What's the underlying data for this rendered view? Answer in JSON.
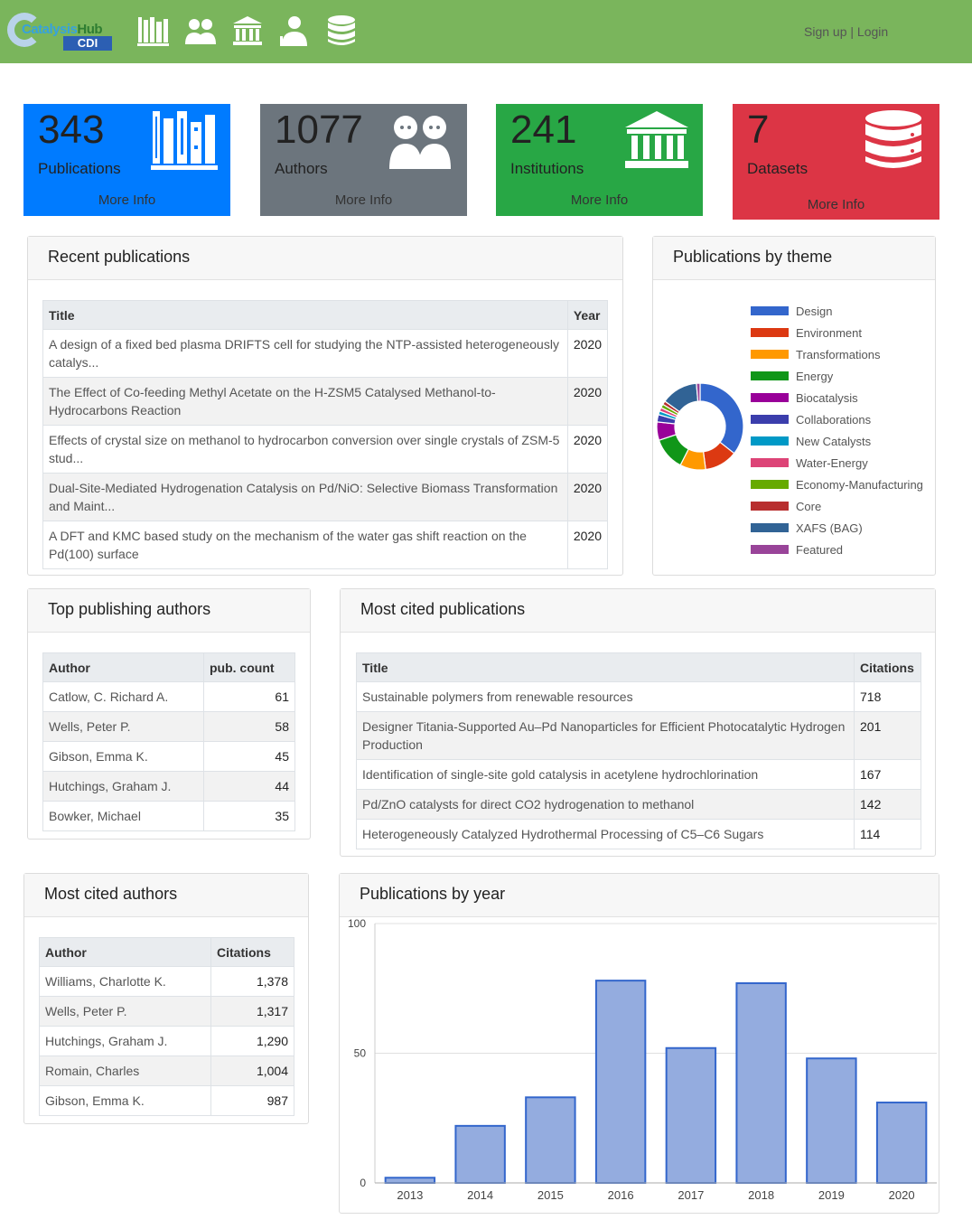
{
  "brand": {
    "logo_text_a": "Catalysis",
    "logo_text_b": "Hub",
    "logo_sub": "CDI"
  },
  "nav": {
    "icons": [
      "publications-icon",
      "authors-icon",
      "institutions-icon",
      "experts-icon",
      "datasets-icon"
    ]
  },
  "auth": {
    "signup": "Sign up",
    "sep": "|",
    "login": "Login"
  },
  "stats": [
    {
      "value": "343",
      "label": "Publications",
      "more": "More Info",
      "color": "#007bff",
      "icon": "books-icon"
    },
    {
      "value": "1077",
      "label": "Authors",
      "more": "More Info",
      "color": "#6c757d",
      "icon": "people-icon"
    },
    {
      "value": "241",
      "label": "Institutions",
      "more": "More Info",
      "color": "#28a745",
      "icon": "bank-icon"
    },
    {
      "value": "7",
      "label": "Datasets",
      "more": "More Info",
      "color": "#dc3545",
      "icon": "database-icon"
    }
  ],
  "recent": {
    "title": "Recent publications",
    "col_title": "Title",
    "col_year": "Year",
    "rows": [
      {
        "title": "A design of a fixed bed plasma DRIFTS cell for studying the NTP-assisted heterogeneously catalys...",
        "year": "2020"
      },
      {
        "title": "The Effect of Co-feeding Methyl Acetate on the H-ZSM5 Catalysed Methanol-to-Hydrocarbons Reaction",
        "year": "2020"
      },
      {
        "title": "Effects of crystal size on methanol to hydrocarbon conversion over single crystals of ZSM-5 stud...",
        "year": "2020"
      },
      {
        "title": "Dual-Site-Mediated Hydrogenation Catalysis on Pd/NiO: Selective Biomass Transformation and Maint...",
        "year": "2020"
      },
      {
        "title": "A DFT and KMC based study on the mechanism of the water gas shift reaction on the Pd(100) surface",
        "year": "2020"
      }
    ]
  },
  "theme": {
    "title": "Publications by theme",
    "items": [
      {
        "name": "Design",
        "color": "#3366cc"
      },
      {
        "name": "Environment",
        "color": "#dc3912"
      },
      {
        "name": "Transformations",
        "color": "#ff9900"
      },
      {
        "name": "Energy",
        "color": "#109618"
      },
      {
        "name": "Biocatalysis",
        "color": "#990099"
      },
      {
        "name": "Collaborations",
        "color": "#3b3eac"
      },
      {
        "name": "New Catalysts",
        "color": "#0099c6"
      },
      {
        "name": "Water-Energy",
        "color": "#dd4477"
      },
      {
        "name": "Economy-Manufacturing",
        "color": "#66aa00"
      },
      {
        "name": "Core",
        "color": "#b82e2e"
      },
      {
        "name": "XAFS (BAG)",
        "color": "#316395"
      },
      {
        "name": "Featured",
        "color": "#994499"
      }
    ]
  },
  "topauthors": {
    "title": "Top publishing authors",
    "col_author": "Author",
    "col_count": "pub. count",
    "rows": [
      {
        "name": "Catlow, C. Richard A.",
        "count": "61"
      },
      {
        "name": "Wells, Peter P.",
        "count": "58"
      },
      {
        "name": "Gibson, Emma K.",
        "count": "45"
      },
      {
        "name": "Hutchings, Graham J.",
        "count": "44"
      },
      {
        "name": "Bowker, Michael",
        "count": "35"
      }
    ]
  },
  "mostcited": {
    "title": "Most cited publications",
    "col_title": "Title",
    "col_cit": "Citations",
    "rows": [
      {
        "title": "Sustainable polymers from renewable resources",
        "cit": "718"
      },
      {
        "title": "Designer Titania-Supported Au–Pd Nanoparticles for Efficient Photocatalytic Hydrogen Production",
        "cit": "201"
      },
      {
        "title": "Identification of single-site gold catalysis in acetylene hydrochlorination",
        "cit": "167"
      },
      {
        "title": "Pd/ZnO catalysts for direct CO2 hydrogenation to methanol",
        "cit": "142"
      },
      {
        "title": "Heterogeneously Catalyzed Hydrothermal Processing of C5–C6 Sugars",
        "cit": "114"
      }
    ]
  },
  "citedauthors": {
    "title": "Most cited authors",
    "col_author": "Author",
    "col_cit": "Citations",
    "rows": [
      {
        "name": "Williams, Charlotte K.",
        "cit": "1,378"
      },
      {
        "name": "Wells, Peter P.",
        "cit": "1,317"
      },
      {
        "name": "Hutchings, Graham J.",
        "cit": "1,290"
      },
      {
        "name": "Romain, Charles",
        "cit": "1,004"
      },
      {
        "name": "Gibson, Emma K.",
        "cit": "987"
      }
    ]
  },
  "byyear": {
    "title": "Publications by year"
  },
  "chart_data": [
    {
      "type": "pie",
      "donut": true,
      "labels": [
        "Design",
        "Environment",
        "Transformations",
        "Energy",
        "Biocatalysis",
        "Collaborations",
        "New Catalysts",
        "Water-Energy",
        "Economy-Manufacturing",
        "Core",
        "XAFS (BAG)",
        "Featured"
      ],
      "values": [
        26,
        9,
        7,
        9,
        5,
        2,
        1,
        1,
        1,
        1,
        10,
        1
      ],
      "colors": [
        "#3366cc",
        "#dc3912",
        "#ff9900",
        "#109618",
        "#990099",
        "#3b3eac",
        "#0099c6",
        "#dd4477",
        "#66aa00",
        "#b82e2e",
        "#316395",
        "#994499"
      ],
      "legend": "right"
    },
    {
      "type": "bar",
      "categories": [
        "2013",
        "2014",
        "2015",
        "2016",
        "2017",
        "2018",
        "2019",
        "2020"
      ],
      "values": [
        2,
        22,
        33,
        78,
        52,
        77,
        48,
        31
      ],
      "ylim": [
        0,
        100
      ],
      "yticks": [
        "0",
        "50",
        "100"
      ],
      "bar_color": "#94acdf",
      "bar_border": "#3366cc",
      "grid": true
    }
  ]
}
